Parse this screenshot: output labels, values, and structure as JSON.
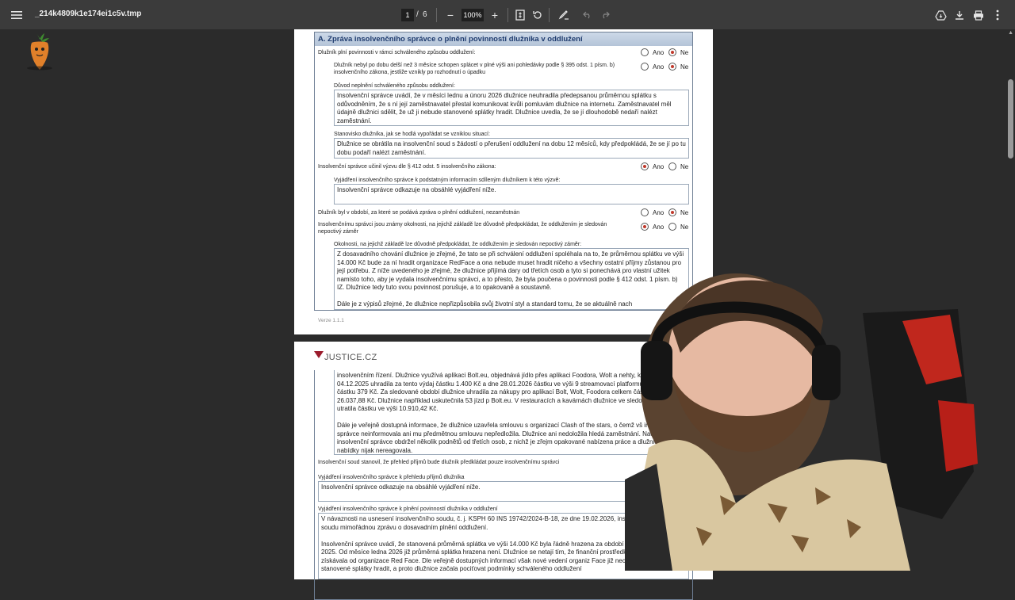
{
  "toolbar": {
    "filename": "_214k4809k1e174ei1c5v.tmp",
    "current_page": "1",
    "separator": "/",
    "total_pages": "6",
    "zoom": "100%",
    "minus": "−",
    "plus": "+"
  },
  "page1": {
    "section_title": "A. Zpráva insolvenčního správce o plnění povinností dlužníka v oddlužení",
    "yes": "Ano",
    "no": "Ne",
    "q1": "Dlužník plní povinnosti v rámci schváleného způsobu oddlužení:",
    "q2": "Dlužník nebyl po dobu delší než 3 měsíce schopen splácet v plné výši ani pohledávky podle § 395 odst. 1 písm. b) insolvenčního zákona, jestliže vznikly po rozhodnutí o úpadku",
    "q3": "Důvod neplnění schváleného způsobu oddlužení:",
    "a3": "Insolvenční správce uvádí, že v měsíci lednu a únoru 2026 dlužnice neuhradila předepsanou průměrnou splátku s odůvodněním, že s ní její zaměstnavatel přestal komunikovat kvůli pomluvám dlužnice na internetu. Zaměstnavatel měl údajně dlužnici sdělit, že už ji nebude stanovené splátky hradit. Dlužnice uvedla, že se jí dlouhodobě nedaří nalézt zaměstnání.",
    "q4": "Stanovisko dlužníka, jak se hodlá vypořádat se vzniklou situací:",
    "a4": "Dlužnice se obrátila na insolvenční soud s žádostí o přerušení oddlužení na dobu 12 měsíců, kdy předpokládá, že se jí po tu dobu podaří nalézt zaměstnání.",
    "q5": "Insolvenční správce učinil výzvu dle § 412 odst. 5 insolvenčního zákona:",
    "q6": "Vyjádření insolvenčního správce k podstatným informacím sdíleným dlužníkem k této výzvě:",
    "a6": "Insolvenční správce odkazuje na obsáhlé vyjádření níže.",
    "q7": "Dlužník byl v období, za které se podává zpráva o plnění oddlužení, nezaměstnán",
    "q8": "Insolvenčnímu správci jsou známy okolnosti, na jejichž základě lze důvodně předpokládat, že oddlužením je sledován nepoctivý záměr",
    "q9": "Okolnosti, na jejichž základě lze důvodně předpokládat, že oddlužením je sledován nepoctivý záměr:",
    "a9": "Z dosavadního chování dlužnice je zřejmé, že tato se při schválení oddlužení spoléhala na to, že průměrnou splátku ve výši 14.000 Kč bude za ní hradit organizace RedFace a ona nebude muset hradit ničeho a všechny ostatní příjmy zůstanou pro její potřebu. Z níže uvedeného je zřejmé, že dlužnice přijímá dary od třetích osob a tyto si ponechává pro vlastní užitek namísto toho, aby je vydala insolvenčnímu správci, a to přesto, že byla poučena o povinnosti podle § 412 odst. 1 písm. b) IZ. Dlužnice tedy tuto svou povinnost porušuje, a to opakovaně a soustavně.\n\nDále je z výpisů zřejmé, že dlužnice nepřizpůsobila svůj životní styl a standard tomu, že se aktuálně nach",
    "version": "Verze  1.1.1"
  },
  "page2": {
    "logo": "JUSTICE.CZ",
    "cont": "insolvenčním řízení. Dlužnice využívá aplikaci Bolt.eu, objednává jídlo přes aplikaci Foodora, Wolt a nehty, kdy dne 04.12.2025 uhradila za tento výdaj částku 1.400 Kč a dne 28.01.2026 částku ve výši 9 streamovací platformu Netflix za částku 379 Kč. Za sledované období dlužnice uhradila za nákupy pro aplikací Bolt, Wolt, Foodora celkem částku ve výši 26.037,88 Kč. Dlužnice například uskutečnila 53 jízd p Bolt.eu. V restauracích a kavárnách dlužnice ve sledovaném období utratila částku ve výši 10.910,42 Kč.\n\nDále je veřejně dostupná informace, že dlužnice uzavřela smlouvu s organizací Clash of the stars, o čemž vš insolvenčního správce neinformovala ani mu předmětnou smlouvu nepředložila. Dlužnice ani nedoložila hledá zaměstnání. Nadto insolvenční správce obdržel několik podnětů od třetích osob, z nichž je zřejm opakované nabízena práce a dlužnice na nabídky nijak nereagovala.",
    "q10": "Insolvenční soud stanovil, že přehled příjmů bude dlužník předkládat pouze insolvenčnímu správci",
    "q11": "Vyjádření insolvenčního správce k přehledu příjmů dlužníka",
    "a11": "Insolvenční správce odkazuje na obsáhlé vyjádření níže.",
    "q12": "Vyjádření insolvenčního správce k plnění povinností dlužníka v oddlužení",
    "a12": "V návaznosti na usnesení insolvenčního soudu, č. j. KSPH 60 INS 19742/2024-B-18, ze dne 19.02.2026, insolven tímto podává soudu mimořádnou zprávu o dosavadním plnění oddlužení.\n\nInsolvenční správce uvádí, že stanovená průměrná splátka ve výši 14.000 Kč byla řádně hrazena za období červen 20 prosinec 2025. Od měsíce ledna 2026 již průměrná splátka hrazena není. Dlužnice se netají tím, že finanční prostředk stanovenou splátku získávala od organizace Red Face. Dle veřejně dostupných informací však nové vedení organiz Face již nechce dlužnici stanovené splátky hradit, a proto dlužnice začala pociťovat podmínky schváleného oddlužení"
  },
  "colors": {
    "toolbar_bg": "#3b3b3b",
    "viewer_bg": "#2b2b2b",
    "section_header": "#b4c4d8",
    "radio_selected": "#c0392b"
  }
}
